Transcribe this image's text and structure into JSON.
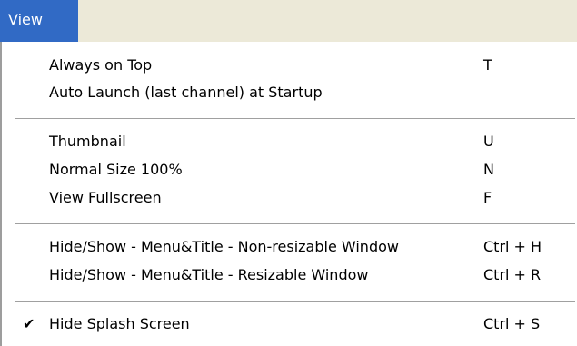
{
  "menu": {
    "title": "View",
    "colors": {
      "highlight_bg": "#316ac5",
      "menubar_bg": "#ece9d8",
      "panel_bg": "#ffffff"
    },
    "groups": [
      {
        "items": [
          {
            "label": "Always on Top",
            "shortcut": "T",
            "checked": false
          },
          {
            "label": "Auto Launch (last channel) at Startup",
            "shortcut": "",
            "checked": false
          }
        ]
      },
      {
        "items": [
          {
            "label": "Thumbnail",
            "shortcut": "U",
            "checked": false
          },
          {
            "label": "Normal Size 100%",
            "shortcut": "N",
            "checked": false
          },
          {
            "label": "View Fullscreen",
            "shortcut": "F",
            "checked": false
          }
        ]
      },
      {
        "items": [
          {
            "label": "Hide/Show - Menu&Title - Non-resizable Window",
            "shortcut": "Ctrl + H",
            "checked": false
          },
          {
            "label": "Hide/Show - Menu&Title - Resizable Window",
            "shortcut": "Ctrl + R",
            "checked": false
          }
        ]
      },
      {
        "items": [
          {
            "label": "Hide Splash Screen",
            "shortcut": "Ctrl + S",
            "checked": true,
            "check_icon": "checkmark-icon"
          }
        ]
      }
    ]
  }
}
